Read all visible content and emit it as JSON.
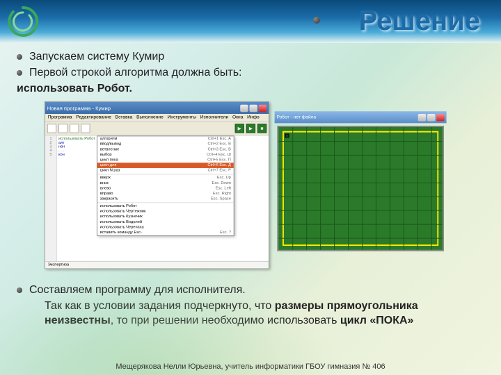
{
  "slide": {
    "title": "Решение",
    "bullets_top": [
      "Запускаем систему Кумир",
      "Первой строкой алгоритма должна быть:"
    ],
    "top_followup": "использовать Робот.",
    "bullets_bottom": [
      "Составляем программу для исполнителя."
    ],
    "bottom_followup_parts": {
      "p1": "Так как в условии задания подчеркнуто, что ",
      "b1": "размеры прямоугольника неизвестны",
      "p2": ", то при решении необходимо использовать ",
      "b2": "цикл «ПОКА»"
    },
    "footer": "Мещерякова Нелли Юрьевна, учитель информатики ГБОУ гимназия № 406"
  },
  "app": {
    "title": "Новая программа - Кумир",
    "menus": [
      "Программа",
      "Редактирование",
      "Вставка",
      "Выполнение",
      "Инструменты",
      "Исполнители",
      "Окна",
      "Инфо"
    ],
    "gutter_lines": [
      "1",
      "2",
      "3",
      "4",
      "5"
    ],
    "code_lines": [
      "использовать Робот",
      "алг",
      "нач",
      ". . .",
      "кон"
    ],
    "dropdown": [
      {
        "l": "алгоритм",
        "k": "Ctrl+1",
        "s": "Esc. A"
      },
      {
        "l": "ввод/вывод",
        "k": "Ctrl+2",
        "s": "Esc. B"
      },
      {
        "l": "ветвление",
        "k": "Ctrl+3",
        "s": "Esc. В"
      },
      {
        "l": "выбор",
        "k": "Ctrl+4",
        "s": "Esc. Ш"
      },
      {
        "l": "цикл пока",
        "k": "Ctrl+5",
        "s": "Esc. П"
      },
      {
        "l": "цикл для",
        "k": "Ctrl+6",
        "s": "Esc. Д",
        "sel": true
      },
      {
        "l": "цикл N раз",
        "k": "Ctrl+7",
        "s": "Esc. Р"
      },
      {
        "l": "вверх",
        "k": "",
        "s": "Esc. Up"
      },
      {
        "l": "вниз",
        "k": "",
        "s": "Esc. Down"
      },
      {
        "l": "влево",
        "k": "",
        "s": "Esc. Left"
      },
      {
        "l": "вправо",
        "k": "",
        "s": "Esc. Right"
      },
      {
        "l": "закрасить",
        "k": "",
        "s": "Esc. Space"
      },
      {
        "l": "использовать Робот",
        "k": "",
        "s": ""
      },
      {
        "l": "использовать Чертежник",
        "k": "",
        "s": ""
      },
      {
        "l": "использовать Кузнечик",
        "k": "",
        "s": ""
      },
      {
        "l": "использовать Водолей",
        "k": "",
        "s": ""
      },
      {
        "l": "использовать Черепаха",
        "k": "",
        "s": ""
      },
      {
        "l": "вставить команду Esc-",
        "k": "",
        "s": "Esc. ?"
      }
    ],
    "log_label": "Экспертиза"
  },
  "robot": {
    "title": "Робот - нет файла"
  }
}
